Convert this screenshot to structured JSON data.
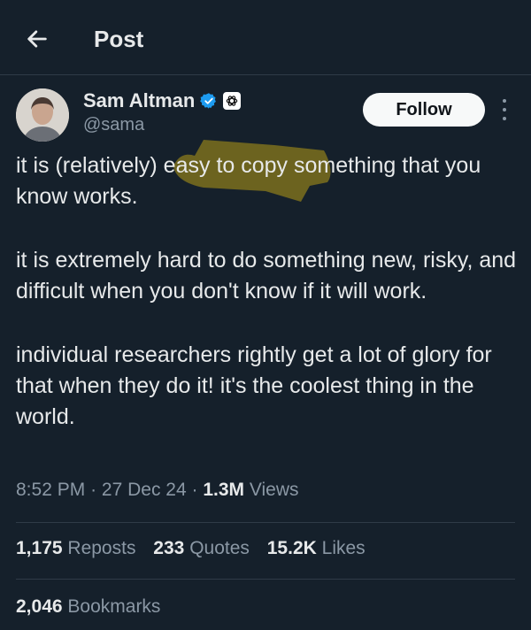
{
  "header": {
    "title": "Post",
    "back_icon": "arrow-left-icon"
  },
  "author": {
    "name": "Sam Altman",
    "handle": "@sama",
    "verified_icon": "verified-badge-icon",
    "affiliation_icon": "openai-logo-icon"
  },
  "follow_label": "Follow",
  "tweet": {
    "paragraphs": [
      "it is (relatively) easy to copy something that you know works.",
      "it is extremely hard to do something new, risky, and difficult when you don't know if it will work.",
      "individual researchers rightly get a lot of glory for that when they do it! it's the coolest thing in the world."
    ],
    "highlighted_phrase": "easy to copy"
  },
  "meta": {
    "time": "8:52 PM",
    "date": "27 Dec 24",
    "views_count": "1.3M",
    "views_label": "Views"
  },
  "stats": {
    "reposts_count": "1,175",
    "reposts_label": "Reposts",
    "quotes_count": "233",
    "quotes_label": "Quotes",
    "likes_count": "15.2K",
    "likes_label": "Likes",
    "bookmarks_count": "2,046",
    "bookmarks_label": "Bookmarks"
  },
  "colors": {
    "background": "#15202b",
    "text": "#e7e9ea",
    "secondary_text": "#8b98a5",
    "verified_blue": "#1d9bf0",
    "highlight": "#8a7a1c"
  }
}
